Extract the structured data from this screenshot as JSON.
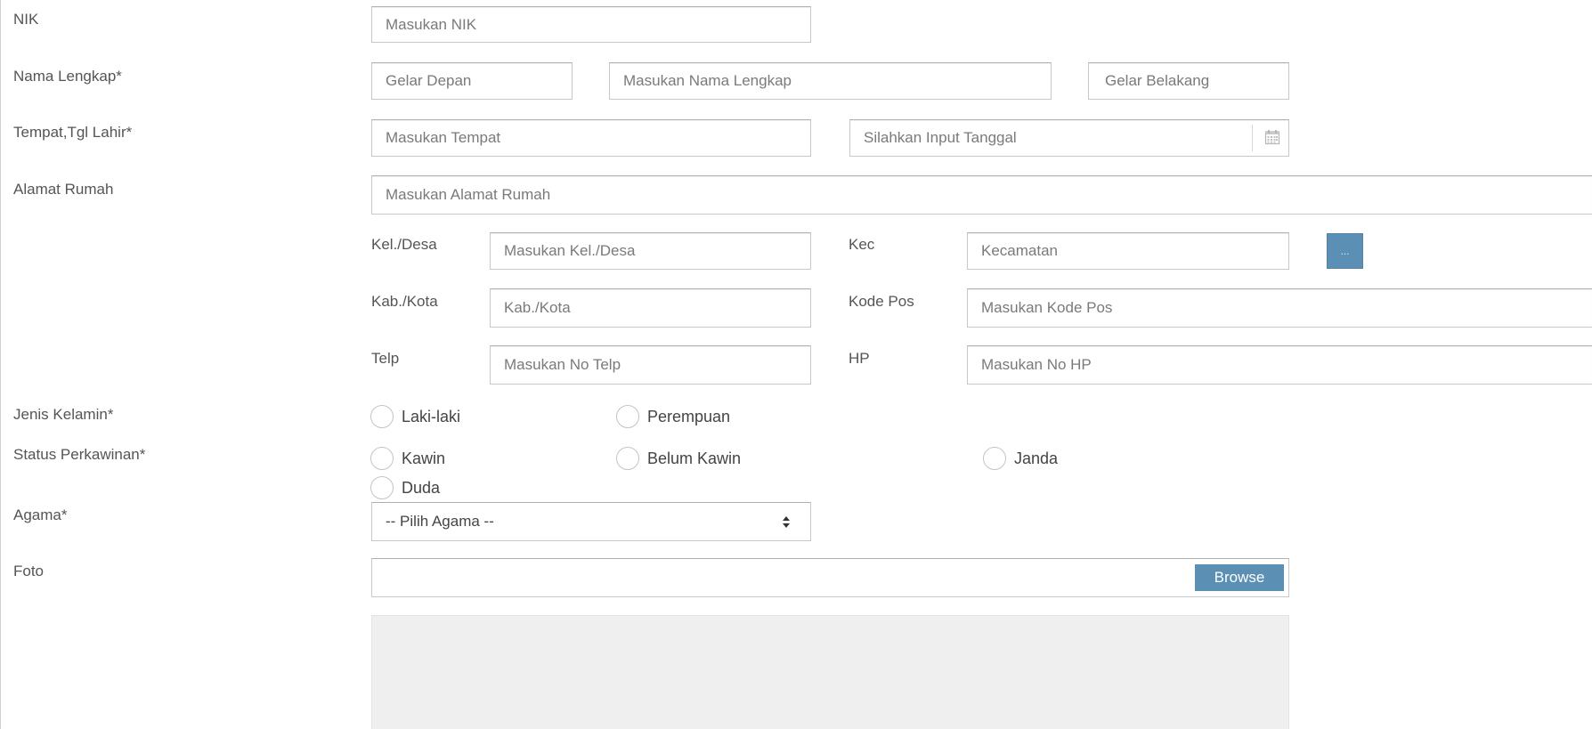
{
  "labels": {
    "nik": "NIK",
    "nama_lengkap": "Nama Lengkap*",
    "tempat_tgl_lahir": "Tempat,Tgl Lahir*",
    "alamat_rumah": "Alamat Rumah",
    "kel_desa": "Kel./Desa",
    "kec": "Kec",
    "kab_kota": "Kab./Kota",
    "kode_pos": "Kode Pos",
    "telp": "Telp",
    "hp": "HP",
    "jenis_kelamin": "Jenis Kelamin*",
    "status_perkawinan": "Status Perkawinan*",
    "agama": "Agama*",
    "foto": "Foto"
  },
  "placeholders": {
    "nik": "Masukan NIK",
    "gelar_depan": "Gelar Depan",
    "nama_lengkap": "Masukan Nama Lengkap",
    "gelar_belakang": "Gelar Belakang",
    "tempat": "Masukan Tempat",
    "tanggal": "Silahkan Input Tanggal",
    "alamat": "Masukan Alamat Rumah",
    "kel_desa": "Masukan Kel./Desa",
    "kecamatan": "Kecamatan",
    "kab_kota": "Kab./Kota",
    "kode_pos": "Masukan Kode Pos",
    "telp": "Masukan No Telp",
    "hp": "Masukan No HP"
  },
  "buttons": {
    "kecamatan_lookup": "...",
    "browse": "Browse"
  },
  "jenis_kelamin_options": [
    "Laki-laki",
    "Perempuan"
  ],
  "status_perkawinan_options": [
    "Kawin",
    "Belum Kawin",
    "Janda",
    "Duda"
  ],
  "agama_select": {
    "selected": "-- Pilih Agama --"
  },
  "icons": {
    "calendar": "calendar-icon",
    "select_arrows": "chevron-up-down-icon"
  },
  "colors": {
    "primary_button": "#5b8fb3",
    "input_border": "#c8c8c8",
    "label_text": "#555555",
    "preview_background": "#efefef"
  }
}
